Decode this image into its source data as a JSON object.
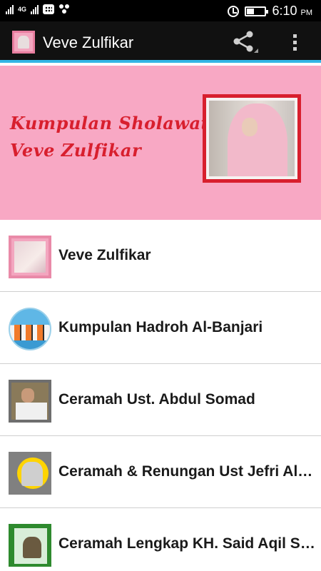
{
  "status_bar": {
    "network_label": "4G",
    "time": "6:10",
    "ampm": "PM"
  },
  "action_bar": {
    "title": "Veve Zulfikar",
    "share_icon": "share-icon",
    "overflow_icon": "overflow-menu-icon"
  },
  "banner": {
    "line1": "Kumpulan Sholawat",
    "line2": "Veve Zulfikar",
    "text_color": "#d81f2e",
    "background": "#f8a8c4"
  },
  "list": {
    "items": [
      {
        "label": "Veve Zulfikar"
      },
      {
        "label": "Kumpulan Hadroh Al-Banjari"
      },
      {
        "label": "Ceramah Ust. Abdul Somad"
      },
      {
        "label": "Ceramah & Renungan Ust Jefri Al Buchori"
      },
      {
        "label": "Ceramah Lengkap KH. Said Aqil Siradj"
      }
    ]
  },
  "colors": {
    "action_bar_bg": "#111111",
    "accent_line": "#33b5e5",
    "divider": "#cfcfcf"
  }
}
